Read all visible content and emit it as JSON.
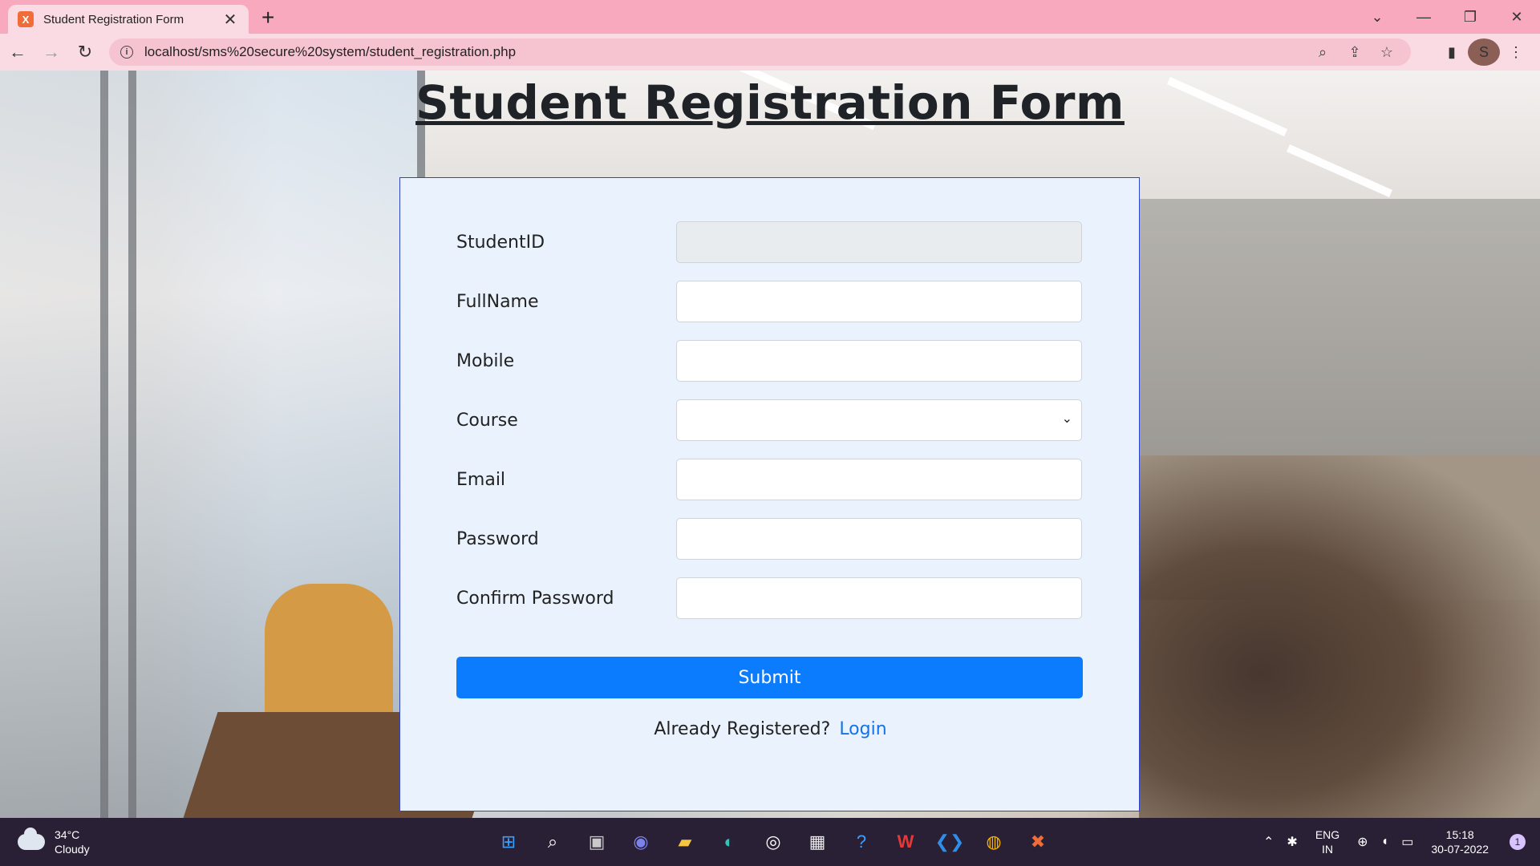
{
  "browser": {
    "tab_title": "Student Registration Form",
    "tab_favicon": "X",
    "url": "localhost/sms%20secure%20system/student_registration.php",
    "profile_initial": "S"
  },
  "page": {
    "title": "Student Registration Form"
  },
  "form": {
    "fields": [
      {
        "label": "StudentID",
        "value": "",
        "placeholder": ""
      },
      {
        "label": "FullName",
        "value": "",
        "placeholder": ""
      },
      {
        "label": "Mobile",
        "value": "",
        "placeholder": ""
      },
      {
        "label": "Course",
        "value": "",
        "placeholder": ""
      },
      {
        "label": "Email",
        "value": "",
        "placeholder": ""
      },
      {
        "label": "Password",
        "value": "",
        "placeholder": ""
      },
      {
        "label": "Confirm Password",
        "value": "",
        "placeholder": ""
      }
    ],
    "submit_label": "Submit",
    "already_text": "Already Registered?",
    "login_label": "Login"
  },
  "taskbar": {
    "temperature": "34°C",
    "weather": "Cloudy",
    "lang_top": "ENG",
    "lang_bottom": "IN",
    "time": "15:18",
    "date": "30-07-2022",
    "notification_count": "1"
  },
  "colors": {
    "tabbar": "#f8a9bd",
    "primary_button": "#0a7cfd",
    "card_border": "#2f44c9",
    "link": "#1474e6"
  }
}
